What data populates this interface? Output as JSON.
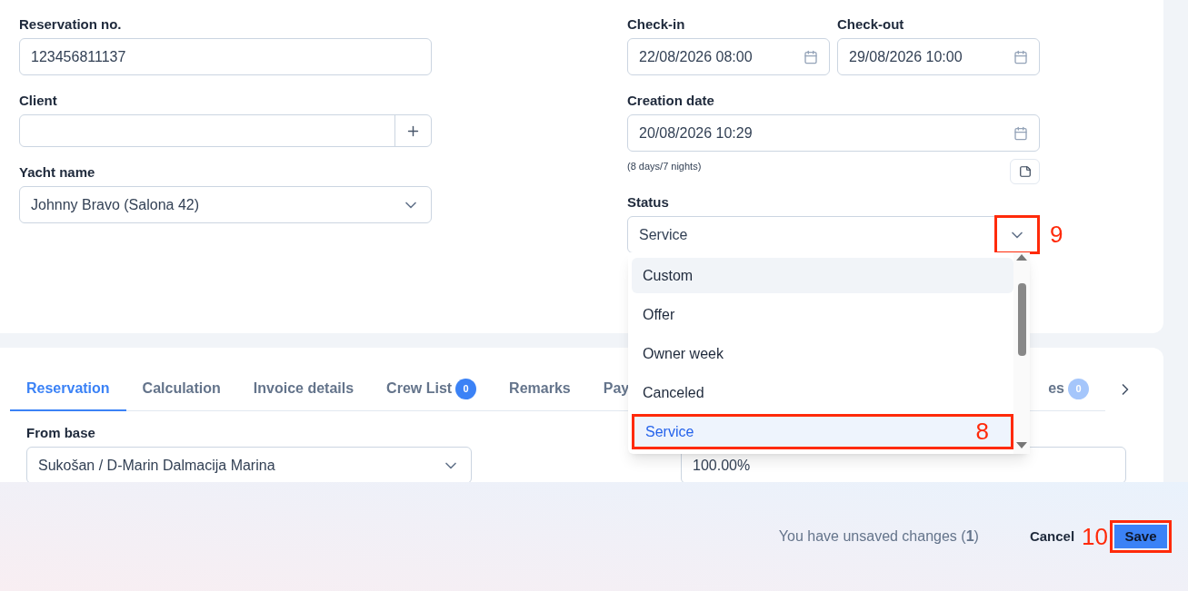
{
  "reservation": {
    "label": "Reservation no.",
    "value": "123456811137"
  },
  "client": {
    "label": "Client"
  },
  "yacht": {
    "label": "Yacht name",
    "value": "Johnny Bravo (Salona 42)"
  },
  "check_in": {
    "label": "Check-in",
    "value": "22/08/2026 08:00"
  },
  "check_out": {
    "label": "Check-out",
    "value": "29/08/2026 10:00"
  },
  "creation": {
    "label": "Creation date",
    "value": "20/08/2026 10:29",
    "note": "(8 days/7 nights)"
  },
  "status": {
    "label": "Status",
    "value": "Service",
    "annotation": "9",
    "options": [
      {
        "label": "Custom",
        "hovered": true,
        "selected": false
      },
      {
        "label": "Offer",
        "hovered": false,
        "selected": false
      },
      {
        "label": "Owner week",
        "hovered": false,
        "selected": false
      },
      {
        "label": "Canceled",
        "hovered": false,
        "selected": false
      },
      {
        "label": "Service",
        "hovered": false,
        "selected": true,
        "annotation": "8"
      }
    ]
  },
  "tabs": [
    {
      "label": "Reservation",
      "selected": true
    },
    {
      "label": "Calculation",
      "selected": false
    },
    {
      "label": "Invoice details",
      "selected": false
    },
    {
      "label": "Crew List",
      "badge": "0",
      "selected": false,
      "faded": false
    },
    {
      "label": "Remarks",
      "selected": false
    },
    {
      "label": "Pay",
      "selected": false
    },
    {
      "label": "es",
      "badge": "0",
      "selected": false,
      "faded": true
    }
  ],
  "from_base": {
    "label": "From base",
    "value": "Sukošan / D-Marin Dalmacija Marina"
  },
  "percent_field": {
    "value": "100.00%"
  },
  "footer": {
    "message": "You have unsaved changes (**1**)",
    "cancel": "Cancel",
    "save": "Save",
    "save_annotation": "10"
  }
}
